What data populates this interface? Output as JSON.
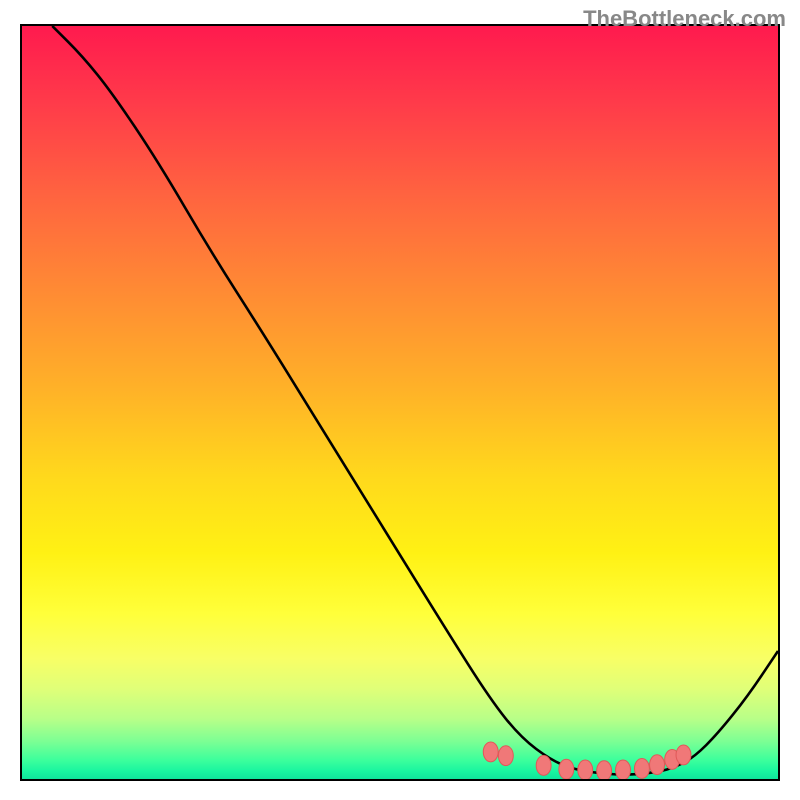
{
  "watermark": "TheBottleneck.com",
  "chart_data": {
    "type": "line",
    "title": "",
    "xlabel": "",
    "ylabel": "",
    "xlim": [
      0,
      100
    ],
    "ylim": [
      0,
      100
    ],
    "curve": {
      "x": [
        4.0,
        8.0,
        12.0,
        18.0,
        25.0,
        32.0,
        40.0,
        48.0,
        56.0,
        62.0,
        66.0,
        70.0,
        73.0,
        76.0,
        80.0,
        84.0,
        86.5,
        89.0,
        92.0,
        96.0,
        100.0
      ],
      "y": [
        100.0,
        96.0,
        91.0,
        82.0,
        70.0,
        59.0,
        46.0,
        33.0,
        20.0,
        10.5,
        5.5,
        2.5,
        1.3,
        0.8,
        0.5,
        0.9,
        1.6,
        3.0,
        6.0,
        11.0,
        17.0
      ]
    },
    "markers": {
      "x": [
        62.0,
        64.0,
        69.0,
        72.0,
        74.5,
        77.0,
        79.5,
        82.0,
        84.0,
        86.0,
        87.5
      ],
      "y": [
        3.6,
        3.1,
        1.8,
        1.3,
        1.2,
        1.1,
        1.2,
        1.4,
        1.9,
        2.6,
        3.2
      ]
    },
    "curve_color": "#000000",
    "marker_color": "#f07878",
    "marker_outline": "#e05858"
  }
}
